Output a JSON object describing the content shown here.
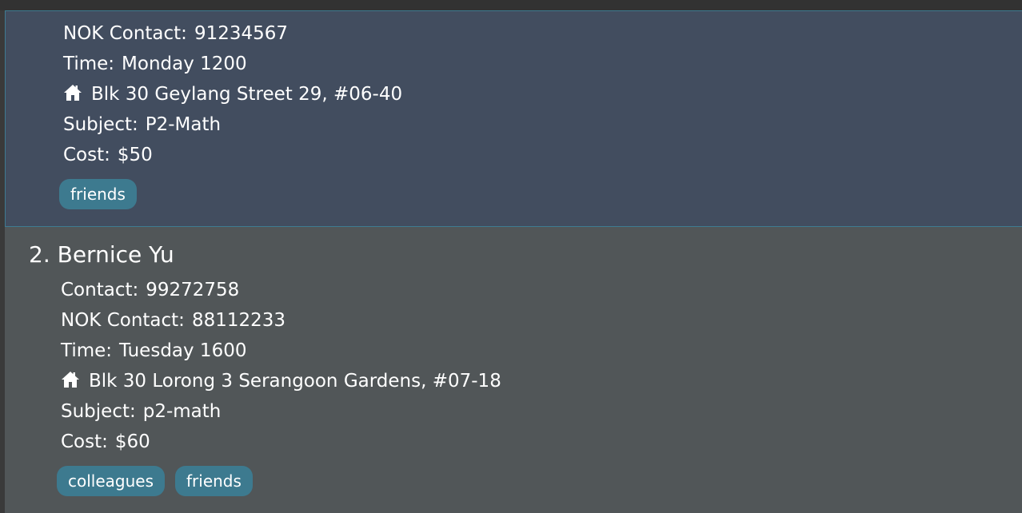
{
  "persons": [
    {
      "nok_contact_label": "NOK Contact:",
      "nok_contact": "91234567",
      "time_label": "Time:",
      "time": "Monday 1200",
      "address": "Blk 30 Geylang Street 29, #06-40",
      "subject_label": "Subject:",
      "subject": "P2-Math",
      "cost_label": "Cost:",
      "cost": "$50",
      "tags": [
        "friends"
      ]
    },
    {
      "name": "2. Bernice Yu",
      "contact_label": "Contact:",
      "contact": "99272758",
      "nok_contact_label": "NOK Contact:",
      "nok_contact": "88112233",
      "time_label": "Time:",
      "time": "Tuesday 1600",
      "address": "Blk 30 Lorong 3 Serangoon Gardens, #07-18",
      "subject_label": "Subject:",
      "subject": "p2-math",
      "cost_label": "Cost:",
      "cost": "$60",
      "tags": [
        "colleagues",
        "friends"
      ]
    }
  ],
  "icons": {
    "address": "home-icon"
  },
  "colors": {
    "selected_card_bg": "#424d5f",
    "selected_card_border": "#3e7b91",
    "card_bg": "#515658",
    "tag_bg": "#3d7a8f",
    "text": "#ffffff"
  }
}
